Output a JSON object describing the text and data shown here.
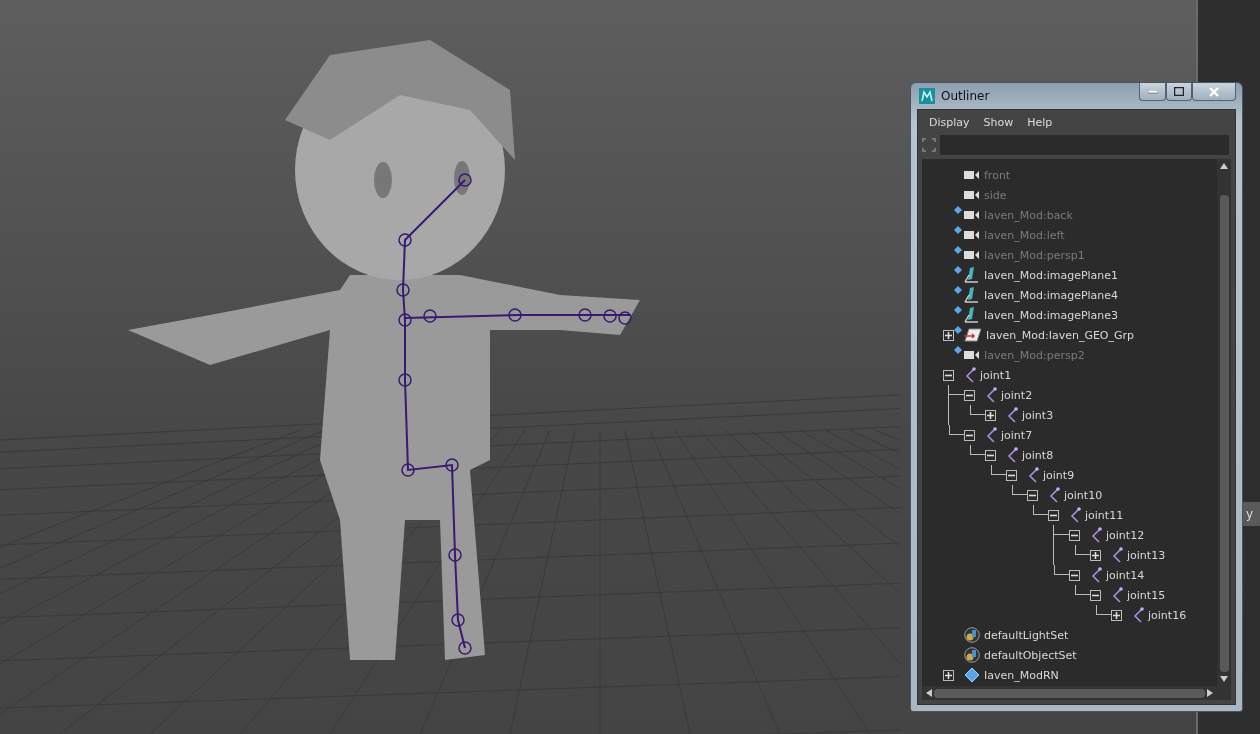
{
  "outliner": {
    "title": "Outliner",
    "menu": [
      "Display",
      "Show",
      "Help"
    ],
    "items": [
      {
        "label": "front",
        "kind": "camera",
        "dimmed": true,
        "referenced": false
      },
      {
        "label": "side",
        "kind": "camera",
        "dimmed": true,
        "referenced": false
      },
      {
        "label": "Iaven_Mod:back",
        "kind": "camera",
        "dimmed": true,
        "referenced": true
      },
      {
        "label": "Iaven_Mod:left",
        "kind": "camera",
        "dimmed": true,
        "referenced": true
      },
      {
        "label": "Iaven_Mod:persp1",
        "kind": "camera",
        "dimmed": true,
        "referenced": true
      },
      {
        "label": "Iaven_Mod:imagePlane1",
        "kind": "imageplane",
        "dimmed": false,
        "referenced": true
      },
      {
        "label": "Iaven_Mod:imagePlane4",
        "kind": "imageplane",
        "dimmed": false,
        "referenced": true
      },
      {
        "label": "Iaven_Mod:imagePlane3",
        "kind": "imageplane",
        "dimmed": false,
        "referenced": true
      },
      {
        "label": "Iaven_Mod:Iaven_GEO_Grp",
        "kind": "group",
        "dimmed": false,
        "referenced": true,
        "expanded": false
      },
      {
        "label": "Iaven_Mod:persp2",
        "kind": "camera",
        "dimmed": true,
        "referenced": true
      },
      {
        "label": "joint1",
        "kind": "joint",
        "dimmed": false,
        "referenced": false,
        "expanded": true,
        "children": [
          {
            "label": "joint2",
            "kind": "joint",
            "dimmed": false,
            "referenced": false,
            "expanded": true,
            "children": [
              {
                "label": "joint3",
                "kind": "joint",
                "dimmed": false,
                "referenced": false,
                "expanded": false
              }
            ]
          },
          {
            "label": "joint7",
            "kind": "joint",
            "dimmed": false,
            "referenced": false,
            "expanded": true,
            "children": [
              {
                "label": "joint8",
                "kind": "joint",
                "dimmed": false,
                "referenced": false,
                "expanded": true,
                "children": [
                  {
                    "label": "joint9",
                    "kind": "joint",
                    "dimmed": false,
                    "referenced": false,
                    "expanded": true,
                    "children": [
                      {
                        "label": "joint10",
                        "kind": "joint",
                        "dimmed": false,
                        "referenced": false,
                        "expanded": true,
                        "children": [
                          {
                            "label": "joint11",
                            "kind": "joint",
                            "dimmed": false,
                            "referenced": false,
                            "expanded": true,
                            "children": [
                              {
                                "label": "joint12",
                                "kind": "joint",
                                "dimmed": false,
                                "referenced": false,
                                "expanded": true,
                                "children": [
                                  {
                                    "label": "joint13",
                                    "kind": "joint",
                                    "dimmed": false,
                                    "referenced": false,
                                    "expanded": false
                                  }
                                ]
                              },
                              {
                                "label": "joint14",
                                "kind": "joint",
                                "dimmed": false,
                                "referenced": false,
                                "expanded": true,
                                "children": [
                                  {
                                    "label": "joint15",
                                    "kind": "joint",
                                    "dimmed": false,
                                    "referenced": false,
                                    "expanded": true,
                                    "children": [
                                      {
                                        "label": "joint16",
                                        "kind": "joint",
                                        "dimmed": false,
                                        "referenced": false,
                                        "expanded": false
                                      }
                                    ]
                                  }
                                ]
                              }
                            ]
                          }
                        ]
                      }
                    ]
                  }
                ]
              }
            ]
          }
        ]
      },
      {
        "label": "defaultLightSet",
        "kind": "set",
        "dimmed": false,
        "referenced": false
      },
      {
        "label": "defaultObjectSet",
        "kind": "set",
        "dimmed": false,
        "referenced": false
      },
      {
        "label": "Iaven_ModRN",
        "kind": "reference",
        "dimmed": false,
        "referenced": false,
        "expanded": false
      }
    ]
  },
  "side_panel": {
    "header": "y"
  }
}
